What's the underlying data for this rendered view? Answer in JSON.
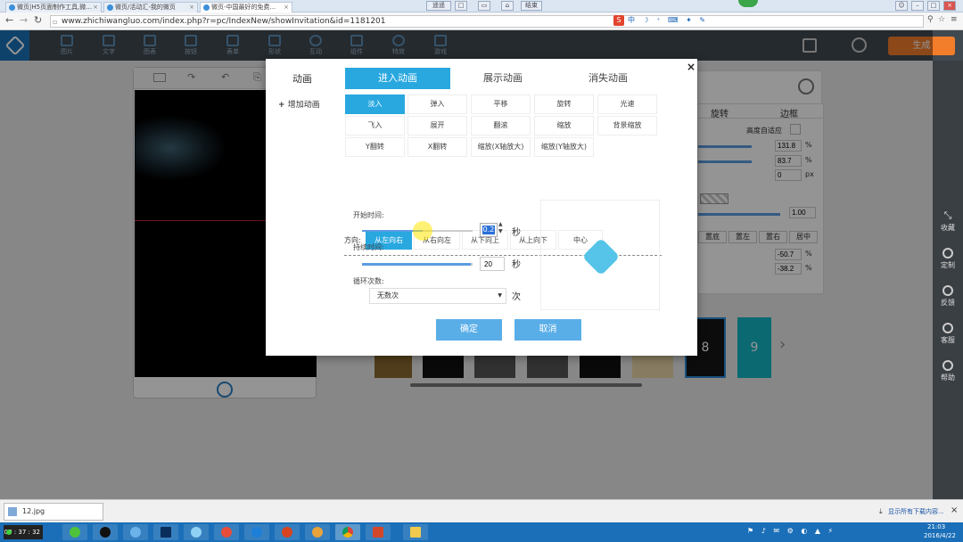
{
  "browser": {
    "tabs": [
      {
        "label": "微页|H5页面制作工具,微..."
      },
      {
        "label": "微页/活动汇-我的微页"
      },
      {
        "label": "微页-中国最好的免费..."
      }
    ],
    "top_right_buttons": [
      "返回",
      "结束"
    ],
    "top_left_hint": "遥遥",
    "url": "www.zhichiwangluo.com/index.php?r=pc/IndexNew/showInvitation&id=1181201"
  },
  "toolbar": {
    "tools": [
      "图片",
      "文字",
      "图表",
      "按钮",
      "表单",
      "形状",
      "互动",
      "组件",
      "特效",
      "游戏"
    ],
    "generate_label": "生成"
  },
  "right_sidebar": [
    "收藏",
    "定制",
    "反馈",
    "客服",
    "帮助"
  ],
  "props_panel": {
    "tabs": [
      "旋转",
      "边框"
    ],
    "auto_height_label": "高度自适应",
    "rows": [
      {
        "value": "131.8",
        "unit": "%"
      },
      {
        "value": "83.7",
        "unit": "%"
      },
      {
        "value": "0",
        "unit": "px"
      }
    ],
    "opacity_value": "1.00",
    "align_buttons": [
      "置底",
      "置左",
      "置右",
      "居中"
    ],
    "rows2": [
      {
        "value": "-50.7",
        "unit": "%"
      },
      {
        "value": "-38.2",
        "unit": "%"
      }
    ]
  },
  "thumbnails": {
    "visible_numbers": [
      "8",
      "9"
    ]
  },
  "dialog": {
    "left_title": "动画",
    "add_animation_label": "增加动画",
    "tabs": [
      "进入动画",
      "展示动画",
      "消失动画"
    ],
    "effects": [
      [
        "淡入",
        "弹入",
        "平移",
        "旋转",
        "光速"
      ],
      [
        "飞入",
        "展开",
        "翻滚",
        "缩放",
        "背景缩放"
      ],
      [
        "Y翻转",
        "X翻转",
        "缩放(X轴放大)",
        "缩放(Y轴放大)"
      ]
    ],
    "direction_label": "方向:",
    "directions": [
      "从左向右",
      "从右向左",
      "从下向上",
      "从上向下",
      "中心"
    ],
    "start_time_label": "开始时间:",
    "start_time_value": "0.2",
    "start_time_fraction": 0.55,
    "duration_label": "持续时间:",
    "duration_value": "20",
    "duration_fraction": 0.98,
    "seconds_unit": "秒",
    "loop_label": "循环次数:",
    "loop_value": "无数次",
    "loop_unit": "次",
    "confirm_label": "确定",
    "cancel_label": "取消"
  },
  "download_bar": {
    "file": "12.jpg",
    "show_all": "显示所有下载内容..."
  },
  "taskbar": {
    "timer": "00 : 37 : 32",
    "time": "21:03",
    "date": "2016/4/22"
  },
  "colors": {
    "accent": "#29a8e0",
    "button_blue": "#5aaee8",
    "generate": "#f27d2b",
    "toolbar": "#414950"
  }
}
